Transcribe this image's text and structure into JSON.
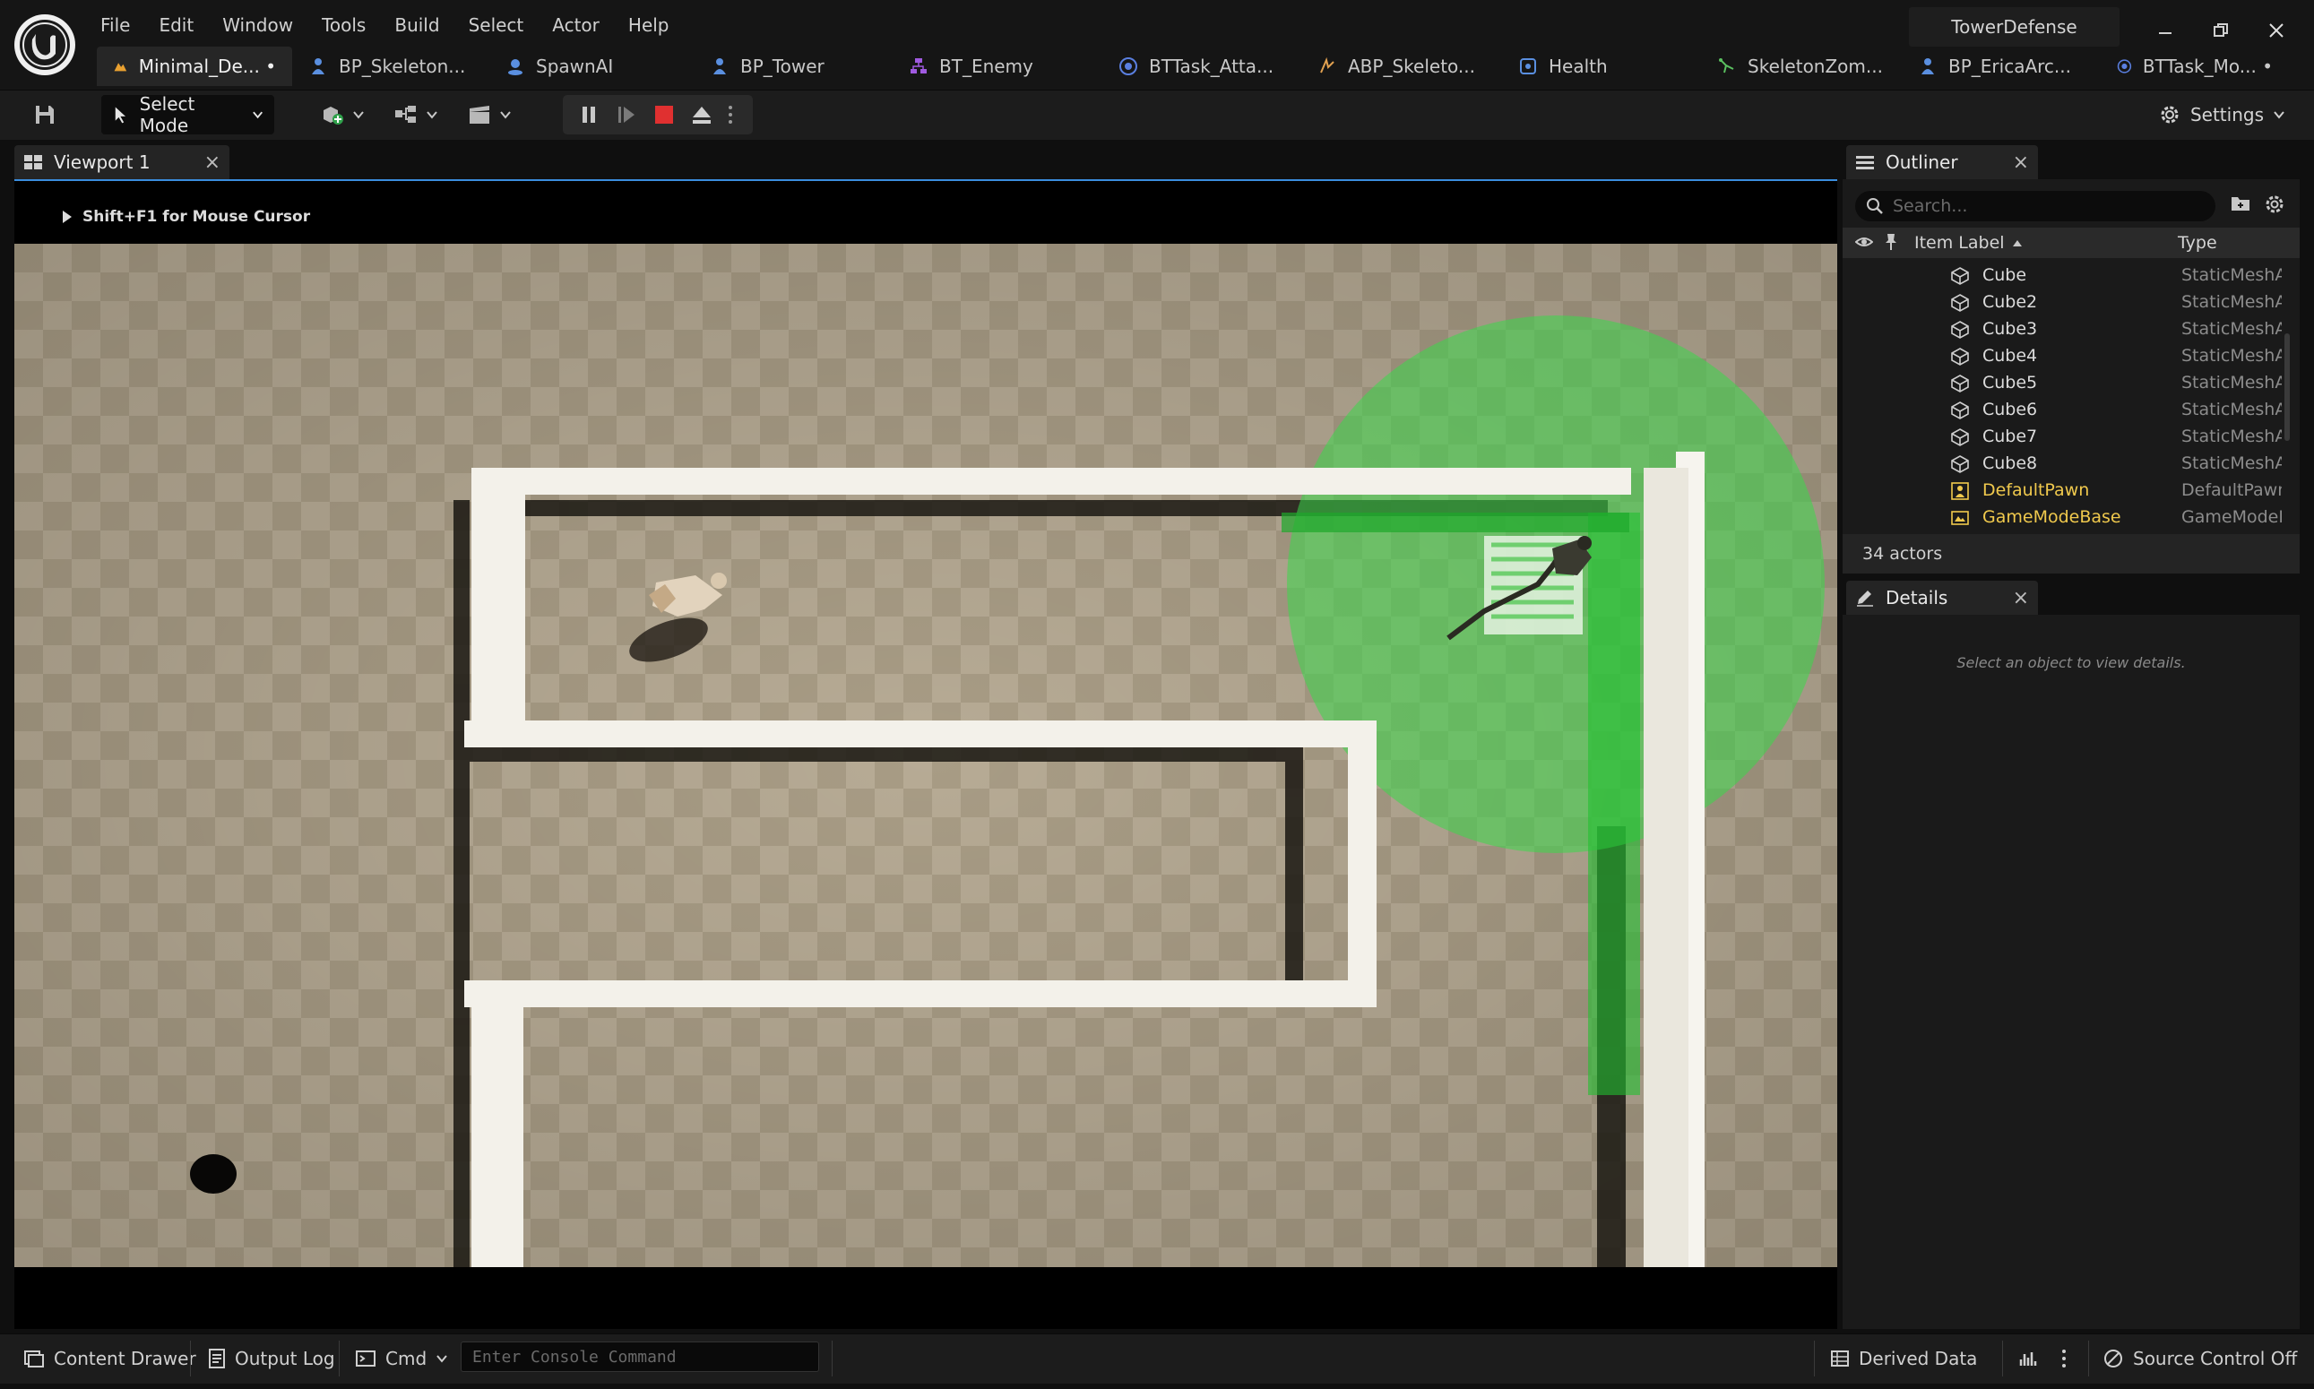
{
  "menu": [
    "File",
    "Edit",
    "Window",
    "Tools",
    "Build",
    "Select",
    "Actor",
    "Help"
  ],
  "project_name": "TowerDefense",
  "tabs": [
    {
      "label": "Minimal_De... •",
      "icon": "level-icon",
      "color": "#e8a030"
    },
    {
      "label": "BP_Skeleton...",
      "icon": "pawn-blueprint-icon",
      "color": "#5a8fe0"
    },
    {
      "label": "SpawnAI",
      "icon": "ai-pawn-icon",
      "color": "#5a8fe0"
    },
    {
      "label": "BP_Tower",
      "icon": "pawn-blueprint-icon",
      "color": "#5a8fe0"
    },
    {
      "label": "BT_Enemy",
      "icon": "behavior-tree-icon",
      "color": "#a05ae0"
    },
    {
      "label": "BTTask_Atta...",
      "icon": "bt-task-icon",
      "color": "#5a7fe0"
    },
    {
      "label": "ABP_Skeleto...",
      "icon": "anim-blueprint-icon",
      "color": "#e0a050"
    },
    {
      "label": "Health",
      "icon": "interface-icon",
      "color": "#5a8fe0"
    },
    {
      "label": "SkeletonZom...",
      "icon": "skeleton-icon",
      "color": "#5ac060"
    },
    {
      "label": "BP_EricaArc...",
      "icon": "pawn-blueprint-icon",
      "color": "#5a8fe0"
    },
    {
      "label": "BTTask_Mo... •",
      "icon": "bt-task-icon",
      "color": "#5a7fe0"
    }
  ],
  "toolbar": {
    "select_mode": "Select Mode",
    "settings": "Settings"
  },
  "viewport": {
    "tab_label": "Viewport 1",
    "hint": "Shift+F1 for Mouse Cursor"
  },
  "outliner": {
    "tab_label": "Outliner",
    "search_placeholder": "Search...",
    "col_label": "Item Label",
    "col_type": "Type",
    "rows": [
      {
        "label": "Cube",
        "type": "StaticMeshA",
        "icon": "static-mesh-icon"
      },
      {
        "label": "Cube2",
        "type": "StaticMeshA",
        "icon": "static-mesh-icon"
      },
      {
        "label": "Cube3",
        "type": "StaticMeshA",
        "icon": "static-mesh-icon"
      },
      {
        "label": "Cube4",
        "type": "StaticMeshA",
        "icon": "static-mesh-icon"
      },
      {
        "label": "Cube5",
        "type": "StaticMeshA",
        "icon": "static-mesh-icon"
      },
      {
        "label": "Cube6",
        "type": "StaticMeshA",
        "icon": "static-mesh-icon"
      },
      {
        "label": "Cube7",
        "type": "StaticMeshA",
        "icon": "static-mesh-icon"
      },
      {
        "label": "Cube8",
        "type": "StaticMeshA",
        "icon": "static-mesh-icon"
      },
      {
        "label": "DefaultPawn",
        "type": "DefaultPawn",
        "icon": "pawn-icon",
        "highlight": true
      },
      {
        "label": "GameModeBase",
        "type": "GameModeB",
        "icon": "game-mode-icon",
        "highlight": true
      }
    ],
    "actor_count": "34 actors"
  },
  "details": {
    "tab_label": "Details",
    "empty_text": "Select an object to view details."
  },
  "bottom": {
    "content_drawer": "Content Drawer",
    "output_log": "Output Log",
    "cmd": "Cmd",
    "console_placeholder": "Enter Console Command",
    "derived_data": "Derived Data",
    "source_control": "Source Control Off"
  },
  "colors": {
    "accent_blue": "#3a8dde",
    "stop_red": "#e03030",
    "tower_range_green": "#3ad84a",
    "outliner_highlight": "#f0c94d"
  }
}
